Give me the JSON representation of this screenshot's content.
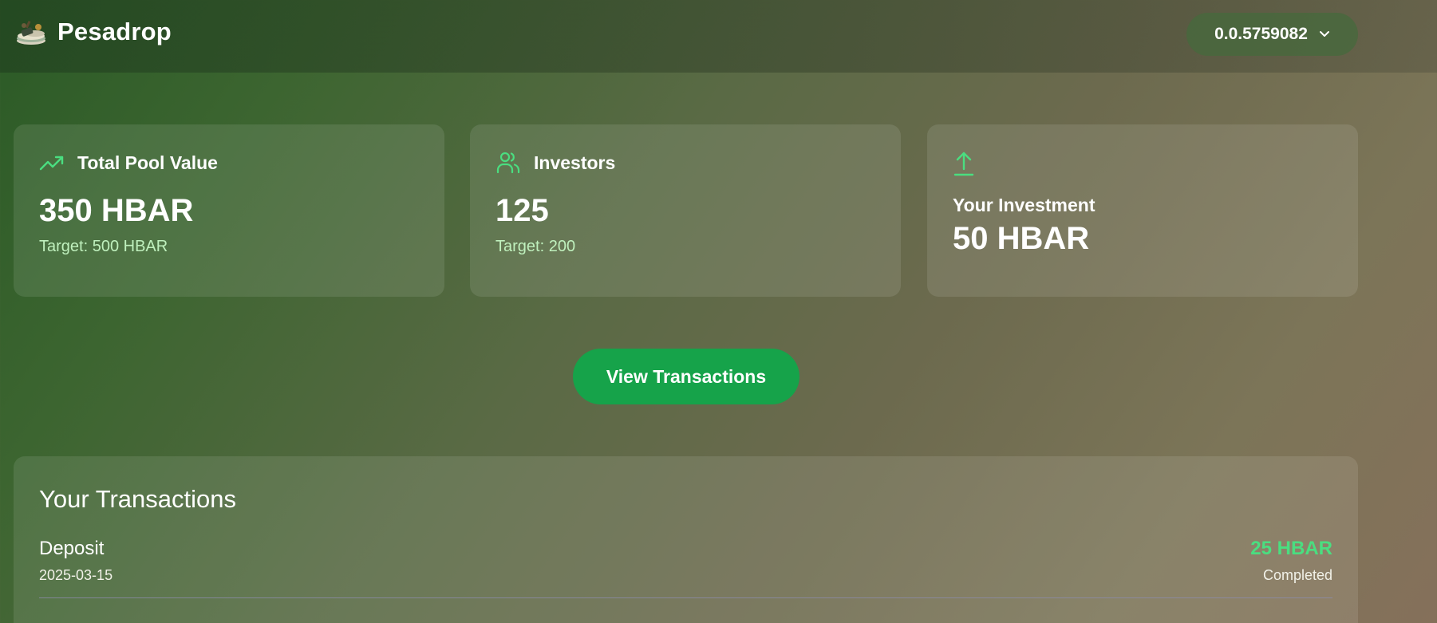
{
  "header": {
    "brand_name": "Pesadrop",
    "account_id": "0.0.5759082",
    "logo_icon": "money-stack-logo",
    "account_menu_icon": "chevron-down-icon"
  },
  "stats": {
    "pool": {
      "title": "Total Pool Value",
      "value": "350 HBAR",
      "target": "Target: 500 HBAR",
      "icon": "trending-up-icon"
    },
    "investors": {
      "title": "Investors",
      "value": "125",
      "target": "Target: 200",
      "icon": "users-icon"
    },
    "investment": {
      "title": "Your Investment",
      "value": "50 HBAR",
      "icon": "upload-icon"
    }
  },
  "actions": {
    "view_transactions_label": "View Transactions"
  },
  "transactions": {
    "title": "Your Transactions",
    "items": [
      {
        "type": "Deposit",
        "date": "2025-03-15",
        "amount": "25 HBAR",
        "status": "Completed"
      }
    ]
  },
  "colors": {
    "accent_green": "#4ade80",
    "button_green": "#16a34a",
    "subtext_green": "#bff0bd"
  }
}
